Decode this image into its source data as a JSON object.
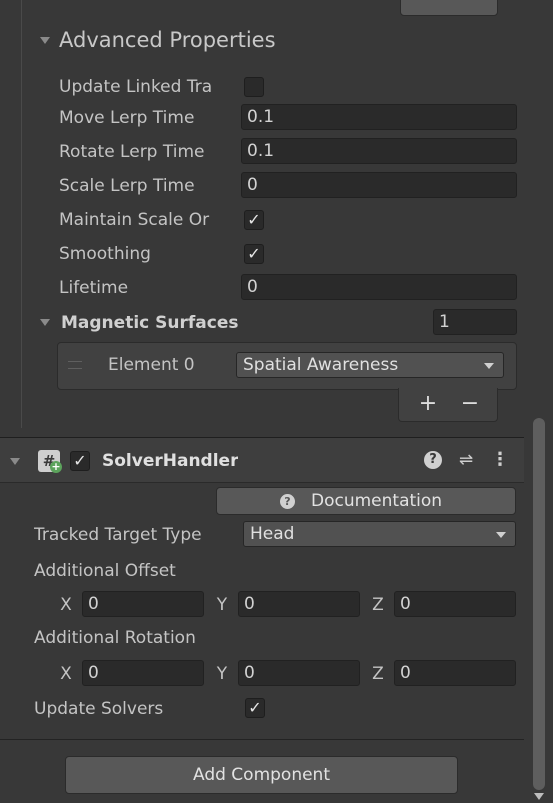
{
  "advanced": {
    "foldout_label": "Advanced Properties",
    "rows": [
      {
        "label": "Update Linked Tra",
        "type": "checkbox",
        "checked": false
      },
      {
        "label": "Move Lerp Time",
        "type": "field",
        "value": "0.1"
      },
      {
        "label": "Rotate Lerp Time",
        "type": "field",
        "value": "0.1"
      },
      {
        "label": "Scale Lerp Time",
        "type": "field",
        "value": "0"
      },
      {
        "label": "Maintain Scale Or",
        "type": "checkbox",
        "checked": true
      },
      {
        "label": "Smoothing",
        "type": "checkbox",
        "checked": true
      },
      {
        "label": "Lifetime",
        "type": "field",
        "value": "0"
      }
    ],
    "magnetic": {
      "label": "Magnetic Surfaces",
      "count": "1",
      "element_label": "Element 0",
      "element_value": "Spatial Awareness",
      "add_symbol": "+",
      "remove_symbol": "−"
    }
  },
  "component": {
    "name": "SolverHandler",
    "enabled": true,
    "help_symbol": "?",
    "preset_symbol": "⇌",
    "menu_symbol": "⋮",
    "documentation_label": "Documentation",
    "tracked_target_type": {
      "label": "Tracked Target Type",
      "value": "Head"
    },
    "additional_offset": {
      "label": "Additional Offset",
      "x_label": "X",
      "y_label": "Y",
      "z_label": "Z",
      "x": "0",
      "y": "0",
      "z": "0"
    },
    "additional_rotation": {
      "label": "Additional Rotation",
      "x_label": "X",
      "y_label": "Y",
      "z_label": "Z",
      "x": "0",
      "y": "0",
      "z": "0"
    },
    "update_solvers": {
      "label": "Update Solvers",
      "checked": true
    }
  },
  "footer": {
    "add_component_label": "Add Component"
  },
  "colors": {
    "panel_bg": "#383838",
    "field_bg": "#2a2a2a",
    "button_bg": "#585858",
    "text": "#c4c4c4"
  },
  "icons": {
    "component_icon": "script-hash-icon",
    "help": "help-icon",
    "preset": "presets-icon",
    "menu": "kebab-menu-icon"
  }
}
